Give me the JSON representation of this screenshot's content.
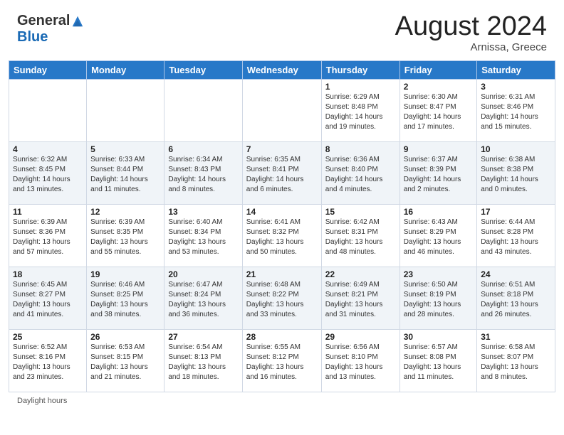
{
  "header": {
    "logo": {
      "general": "General",
      "blue": "Blue",
      "tagline": ""
    },
    "title": "August 2024",
    "location": "Arnissa, Greece"
  },
  "calendar": {
    "days_of_week": [
      "Sunday",
      "Monday",
      "Tuesday",
      "Wednesday",
      "Thursday",
      "Friday",
      "Saturday"
    ],
    "weeks": [
      [
        {
          "day": "",
          "sunrise": "",
          "sunset": "",
          "daylight": ""
        },
        {
          "day": "",
          "sunrise": "",
          "sunset": "",
          "daylight": ""
        },
        {
          "day": "",
          "sunrise": "",
          "sunset": "",
          "daylight": ""
        },
        {
          "day": "",
          "sunrise": "",
          "sunset": "",
          "daylight": ""
        },
        {
          "day": "1",
          "sunrise": "Sunrise: 6:29 AM",
          "sunset": "Sunset: 8:48 PM",
          "daylight": "Daylight: 14 hours and 19 minutes."
        },
        {
          "day": "2",
          "sunrise": "Sunrise: 6:30 AM",
          "sunset": "Sunset: 8:47 PM",
          "daylight": "Daylight: 14 hours and 17 minutes."
        },
        {
          "day": "3",
          "sunrise": "Sunrise: 6:31 AM",
          "sunset": "Sunset: 8:46 PM",
          "daylight": "Daylight: 14 hours and 15 minutes."
        }
      ],
      [
        {
          "day": "4",
          "sunrise": "Sunrise: 6:32 AM",
          "sunset": "Sunset: 8:45 PM",
          "daylight": "Daylight: 14 hours and 13 minutes."
        },
        {
          "day": "5",
          "sunrise": "Sunrise: 6:33 AM",
          "sunset": "Sunset: 8:44 PM",
          "daylight": "Daylight: 14 hours and 11 minutes."
        },
        {
          "day": "6",
          "sunrise": "Sunrise: 6:34 AM",
          "sunset": "Sunset: 8:43 PM",
          "daylight": "Daylight: 14 hours and 8 minutes."
        },
        {
          "day": "7",
          "sunrise": "Sunrise: 6:35 AM",
          "sunset": "Sunset: 8:41 PM",
          "daylight": "Daylight: 14 hours and 6 minutes."
        },
        {
          "day": "8",
          "sunrise": "Sunrise: 6:36 AM",
          "sunset": "Sunset: 8:40 PM",
          "daylight": "Daylight: 14 hours and 4 minutes."
        },
        {
          "day": "9",
          "sunrise": "Sunrise: 6:37 AM",
          "sunset": "Sunset: 8:39 PM",
          "daylight": "Daylight: 14 hours and 2 minutes."
        },
        {
          "day": "10",
          "sunrise": "Sunrise: 6:38 AM",
          "sunset": "Sunset: 8:38 PM",
          "daylight": "Daylight: 14 hours and 0 minutes."
        }
      ],
      [
        {
          "day": "11",
          "sunrise": "Sunrise: 6:39 AM",
          "sunset": "Sunset: 8:36 PM",
          "daylight": "Daylight: 13 hours and 57 minutes."
        },
        {
          "day": "12",
          "sunrise": "Sunrise: 6:39 AM",
          "sunset": "Sunset: 8:35 PM",
          "daylight": "Daylight: 13 hours and 55 minutes."
        },
        {
          "day": "13",
          "sunrise": "Sunrise: 6:40 AM",
          "sunset": "Sunset: 8:34 PM",
          "daylight": "Daylight: 13 hours and 53 minutes."
        },
        {
          "day": "14",
          "sunrise": "Sunrise: 6:41 AM",
          "sunset": "Sunset: 8:32 PM",
          "daylight": "Daylight: 13 hours and 50 minutes."
        },
        {
          "day": "15",
          "sunrise": "Sunrise: 6:42 AM",
          "sunset": "Sunset: 8:31 PM",
          "daylight": "Daylight: 13 hours and 48 minutes."
        },
        {
          "day": "16",
          "sunrise": "Sunrise: 6:43 AM",
          "sunset": "Sunset: 8:29 PM",
          "daylight": "Daylight: 13 hours and 46 minutes."
        },
        {
          "day": "17",
          "sunrise": "Sunrise: 6:44 AM",
          "sunset": "Sunset: 8:28 PM",
          "daylight": "Daylight: 13 hours and 43 minutes."
        }
      ],
      [
        {
          "day": "18",
          "sunrise": "Sunrise: 6:45 AM",
          "sunset": "Sunset: 8:27 PM",
          "daylight": "Daylight: 13 hours and 41 minutes."
        },
        {
          "day": "19",
          "sunrise": "Sunrise: 6:46 AM",
          "sunset": "Sunset: 8:25 PM",
          "daylight": "Daylight: 13 hours and 38 minutes."
        },
        {
          "day": "20",
          "sunrise": "Sunrise: 6:47 AM",
          "sunset": "Sunset: 8:24 PM",
          "daylight": "Daylight: 13 hours and 36 minutes."
        },
        {
          "day": "21",
          "sunrise": "Sunrise: 6:48 AM",
          "sunset": "Sunset: 8:22 PM",
          "daylight": "Daylight: 13 hours and 33 minutes."
        },
        {
          "day": "22",
          "sunrise": "Sunrise: 6:49 AM",
          "sunset": "Sunset: 8:21 PM",
          "daylight": "Daylight: 13 hours and 31 minutes."
        },
        {
          "day": "23",
          "sunrise": "Sunrise: 6:50 AM",
          "sunset": "Sunset: 8:19 PM",
          "daylight": "Daylight: 13 hours and 28 minutes."
        },
        {
          "day": "24",
          "sunrise": "Sunrise: 6:51 AM",
          "sunset": "Sunset: 8:18 PM",
          "daylight": "Daylight: 13 hours and 26 minutes."
        }
      ],
      [
        {
          "day": "25",
          "sunrise": "Sunrise: 6:52 AM",
          "sunset": "Sunset: 8:16 PM",
          "daylight": "Daylight: 13 hours and 23 minutes."
        },
        {
          "day": "26",
          "sunrise": "Sunrise: 6:53 AM",
          "sunset": "Sunset: 8:15 PM",
          "daylight": "Daylight: 13 hours and 21 minutes."
        },
        {
          "day": "27",
          "sunrise": "Sunrise: 6:54 AM",
          "sunset": "Sunset: 8:13 PM",
          "daylight": "Daylight: 13 hours and 18 minutes."
        },
        {
          "day": "28",
          "sunrise": "Sunrise: 6:55 AM",
          "sunset": "Sunset: 8:12 PM",
          "daylight": "Daylight: 13 hours and 16 minutes."
        },
        {
          "day": "29",
          "sunrise": "Sunrise: 6:56 AM",
          "sunset": "Sunset: 8:10 PM",
          "daylight": "Daylight: 13 hours and 13 minutes."
        },
        {
          "day": "30",
          "sunrise": "Sunrise: 6:57 AM",
          "sunset": "Sunset: 8:08 PM",
          "daylight": "Daylight: 13 hours and 11 minutes."
        },
        {
          "day": "31",
          "sunrise": "Sunrise: 6:58 AM",
          "sunset": "Sunset: 8:07 PM",
          "daylight": "Daylight: 13 hours and 8 minutes."
        }
      ]
    ]
  },
  "footer": {
    "daylight_hours": "Daylight hours"
  }
}
